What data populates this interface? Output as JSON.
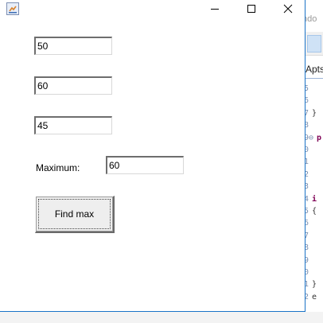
{
  "background_ide": {
    "title_fragment": "ndo",
    "tab_fragment": "Apts",
    "gutter": [
      {
        "num": "5",
        "code": "",
        "kw": false
      },
      {
        "num": "6",
        "code": "",
        "kw": false
      },
      {
        "num": "7",
        "code": "}",
        "kw": false
      },
      {
        "num": "8",
        "code": "",
        "kw": false
      },
      {
        "num": "9⊖",
        "code": "p",
        "kw": true
      },
      {
        "num": "0",
        "code": "",
        "kw": false
      },
      {
        "num": "1",
        "code": "",
        "kw": false
      },
      {
        "num": "2",
        "code": "",
        "kw": false
      },
      {
        "num": "3",
        "code": "",
        "kw": false
      },
      {
        "num": "4",
        "code": "i",
        "kw": true
      },
      {
        "num": "5",
        "code": "{",
        "kw": false
      },
      {
        "num": "6",
        "code": "",
        "kw": false
      },
      {
        "num": "7",
        "code": "",
        "kw": false
      },
      {
        "num": "8",
        "code": "",
        "kw": false
      },
      {
        "num": "9",
        "code": "",
        "kw": false
      },
      {
        "num": "0",
        "code": "",
        "kw": false
      },
      {
        "num": "1",
        "code": "}",
        "kw": false
      },
      {
        "num": "2",
        "code": "e",
        "kw": false
      }
    ]
  },
  "window": {
    "icon": "java-app-icon",
    "controls": [
      "minimize-icon",
      "maximize-icon",
      "close-icon"
    ]
  },
  "form": {
    "field1": "50",
    "field2": "60",
    "field3": "45",
    "maximum_label": "Maximum:",
    "maximum_value": "60",
    "find_button_label": "Find max"
  }
}
